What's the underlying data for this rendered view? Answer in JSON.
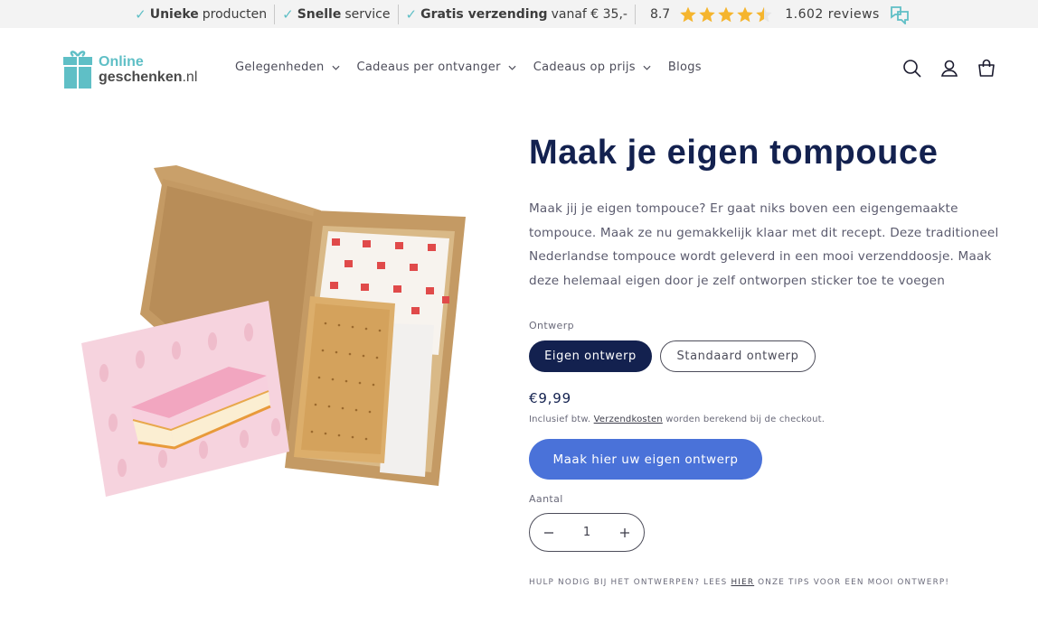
{
  "topbar": {
    "usps": [
      {
        "bold": "Unieke",
        "text": "producten"
      },
      {
        "bold": "Snelle",
        "text": "service"
      },
      {
        "bold": "Gratis verzending",
        "text": "vanaf € 35,-"
      }
    ],
    "rating": {
      "score": "8.7",
      "stars": 4.5,
      "reviews": "1.602 reviews"
    }
  },
  "header": {
    "logo": {
      "line1": "Online",
      "line2": "geschenken",
      "line2_suffix": ".nl"
    },
    "nav": [
      {
        "label": "Gelegenheden",
        "dropdown": true
      },
      {
        "label": "Cadeaus per ontvanger",
        "dropdown": true
      },
      {
        "label": "Cadeaus op prijs",
        "dropdown": true
      },
      {
        "label": "Blogs",
        "dropdown": false
      }
    ],
    "icons": [
      "search-icon",
      "account-icon",
      "cart-icon"
    ]
  },
  "product": {
    "title": "Maak je eigen tompouce",
    "description": "Maak jij je eigen tompouce? Er gaat niks boven een eigengemaakte tompouce. Maak ze nu gemakkelijk klaar met dit recept. Deze traditioneel Nederlandse tompouce wordt geleverd in een mooi verzenddoosje. Maak deze helemaal eigen door je zelf ontworpen sticker toe te voegen",
    "option_label": "Ontwerp",
    "options": [
      {
        "label": "Eigen ontwerp",
        "selected": true
      },
      {
        "label": "Standaard ontwerp",
        "selected": false
      }
    ],
    "price": "€9,99",
    "tax_note": {
      "before": "Inclusief btw.",
      "link": "Verzendkosten",
      "after": "worden berekend bij de checkout."
    },
    "cta_label": "Maak hier uw eigen ontwerp",
    "quantity_label": "Aantal",
    "quantity_value": "1",
    "help": {
      "before": "HULP NODIG BIJ HET ONTWERPEN? LEES",
      "link": "HIER",
      "after": "ONZE TIPS VOOR EEN MOOI ONTWERP!"
    }
  },
  "colors": {
    "navy": "#13214f",
    "accent_blue": "#4a72d9",
    "teal": "#5fbfc6",
    "star": "#f5b52e"
  }
}
